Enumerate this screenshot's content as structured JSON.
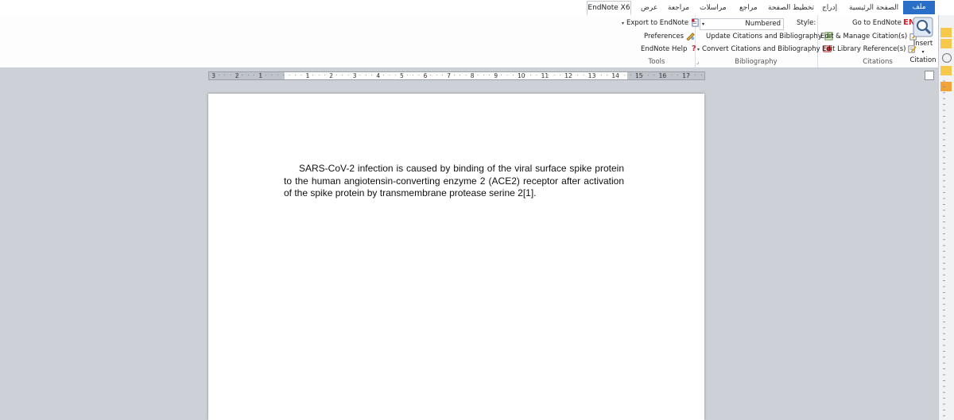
{
  "tabs": {
    "file": "ملف",
    "home": "الصفحة الرئيسية",
    "insert": "إدراج",
    "page_layout": "تخطيط الصفحة",
    "references": "مراجع",
    "mailings": "مراسلات",
    "review": "مراجعة",
    "view": "عرض",
    "endnote": "EndNote X6"
  },
  "ribbon": {
    "tools": {
      "export": "Export to EndNote",
      "preferences": "Preferences",
      "help": "EndNote Help",
      "label": "Tools"
    },
    "bibliography": {
      "style_value": "Numbered",
      "style_label": "Style:",
      "update": "Update Citations and Bibliography",
      "convert": "Convert Citations and Bibliography",
      "label": "Bibliography"
    },
    "citations": {
      "goto": "Go to EndNote",
      "goto_badge": "EN",
      "edit_manage": "Edit & Manage Citation(s)",
      "edit_library": "Edit Library Reference(s)",
      "insert_line1": "Insert",
      "insert_line2": "Citation",
      "label": "Citations"
    }
  },
  "ruler": {
    "left_numbers": [
      "3",
      "2",
      "1"
    ],
    "right_numbers": [
      "1",
      "2",
      "3",
      "4",
      "5",
      "6",
      "7",
      "8",
      "9",
      "10",
      "11",
      "12",
      "13",
      "14",
      "15",
      "16",
      "17"
    ]
  },
  "document": {
    "paragraph": "SARS-CoV-2 infection is caused by binding of the viral surface spike protein to the human angiotensin-converting enzyme 2 (ACE2) receptor after activation of the spike protein by transmembrane protease serine 2[1]."
  },
  "colors": {
    "file_tab": "#2a6fc7",
    "doc_background": "#cdd1d7",
    "en_badge": "#d4202a"
  }
}
